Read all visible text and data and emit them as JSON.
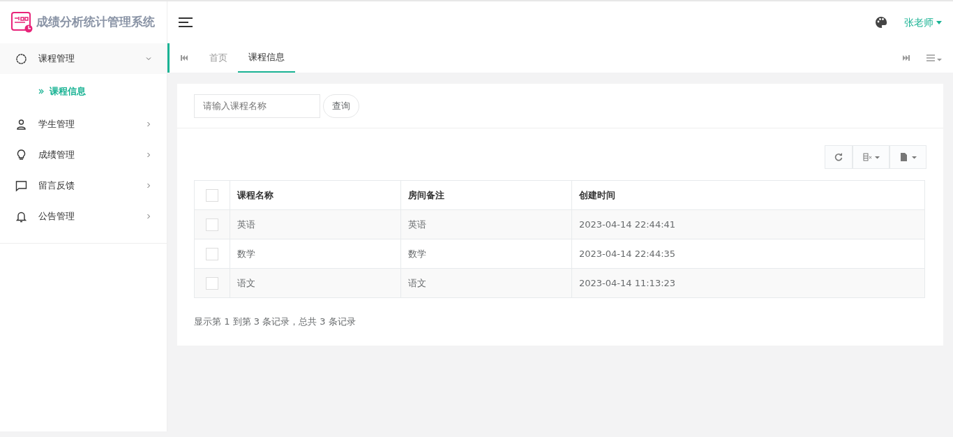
{
  "app": {
    "title": "成绩分析统计管理系统"
  },
  "header": {
    "user": "张老师"
  },
  "sidebar": {
    "items": [
      {
        "label": "课程管理",
        "expanded": true,
        "children": [
          {
            "label": "课程信息",
            "selected": true
          }
        ]
      },
      {
        "label": "学生管理",
        "expanded": false
      },
      {
        "label": "成绩管理",
        "expanded": false
      },
      {
        "label": "留言反馈",
        "expanded": false
      },
      {
        "label": "公告管理",
        "expanded": false
      }
    ]
  },
  "tabs": [
    {
      "label": "首页",
      "selected": false
    },
    {
      "label": "课程信息",
      "selected": true
    }
  ],
  "search": {
    "placeholder": "请输入课程名称",
    "button": "查询"
  },
  "table": {
    "header_checked": false,
    "columns": [
      "课程名称",
      "房间备注",
      "创建时间"
    ],
    "rows": [
      {
        "checked": false,
        "cells": [
          "英语",
          "英语",
          "2023-04-14 22:44:41"
        ]
      },
      {
        "checked": false,
        "cells": [
          "数学",
          "数学",
          "2023-04-14 22:44:35"
        ]
      },
      {
        "checked": false,
        "cells": [
          "语文",
          "语文",
          "2023-04-14 11:13:23"
        ]
      }
    ]
  },
  "pagination_info": "显示第 1 到第 3 条记录，总共 3 条记录"
}
